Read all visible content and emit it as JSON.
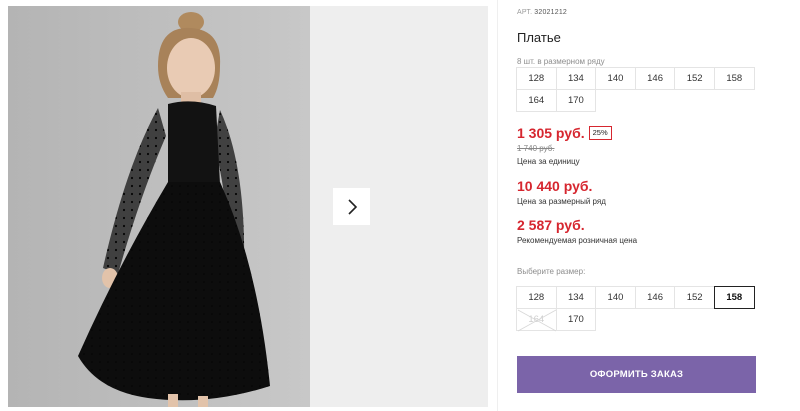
{
  "product": {
    "art_label": "АРТ.",
    "art_value": "32021212",
    "title": "Платье",
    "series_note": "8 шт. в размерном ряду",
    "series_sizes": [
      "128",
      "134",
      "140",
      "146",
      "152",
      "158",
      "164",
      "170"
    ]
  },
  "prices": {
    "unit_price": "1 305 руб.",
    "discount_badge": "25%",
    "old_price": "1 740 руб.",
    "unit_caption": "Цена за единицу",
    "series_price": "10 440 руб.",
    "series_caption": "Цена за размерный ряд",
    "retail_price": "2 587 руб.",
    "retail_caption": "Рекомендуемая розничная цена"
  },
  "size_picker": {
    "label": "Выберите размер:",
    "sizes": [
      {
        "label": "128",
        "state": "available"
      },
      {
        "label": "134",
        "state": "available"
      },
      {
        "label": "140",
        "state": "available"
      },
      {
        "label": "146",
        "state": "available"
      },
      {
        "label": "152",
        "state": "available"
      },
      {
        "label": "158",
        "state": "selected"
      },
      {
        "label": "164",
        "state": "disabled"
      },
      {
        "label": "170",
        "state": "available"
      }
    ]
  },
  "actions": {
    "order_label": "ОФОРМИТЬ ЗАКАЗ"
  },
  "gallery": {
    "next_icon": "chevron-right-icon"
  },
  "colors": {
    "price_red": "#d6262f",
    "button_purple": "#7b64a9",
    "photo_bg": "#bdbdbd",
    "gallery_bg": "#eeeeee"
  }
}
